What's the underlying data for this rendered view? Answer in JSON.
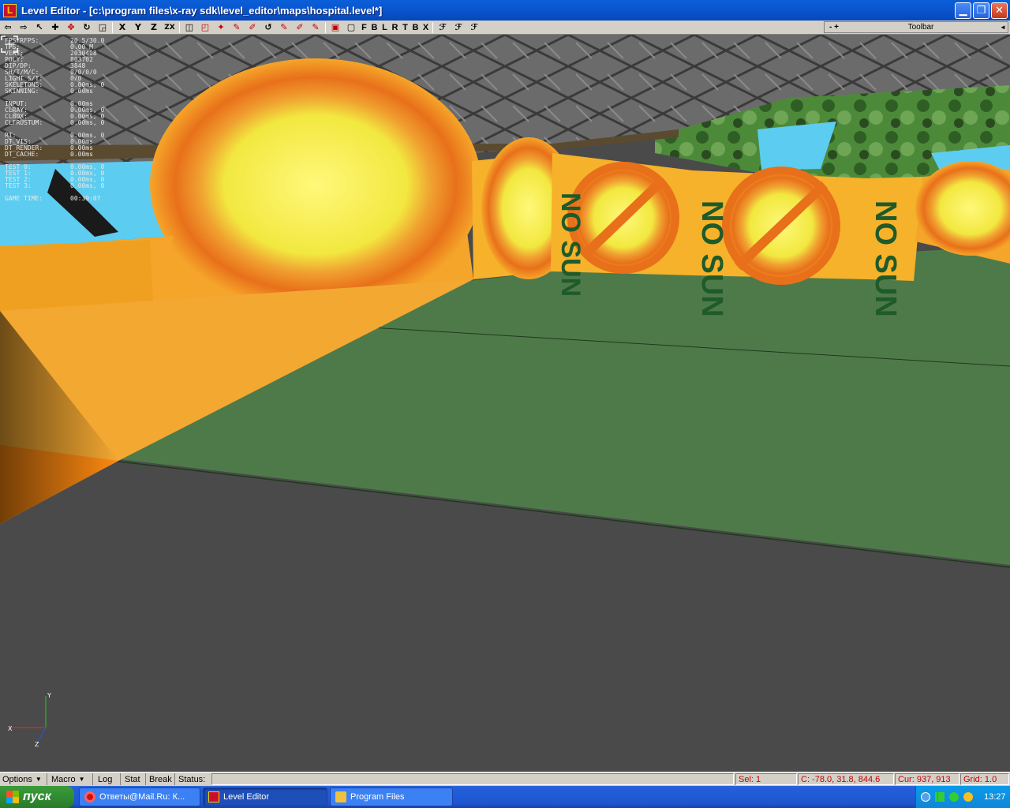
{
  "window": {
    "title": "Level Editor - [c:\\program files\\x-ray sdk\\level_editor\\maps\\hospital.level*]",
    "app_icon_letter": "L",
    "controls": {
      "minimize": "▁",
      "maximize": "❐",
      "close": "✕"
    }
  },
  "toolbar": {
    "panel": {
      "plusminus": "- +",
      "label": "Toolbar",
      "arrow": "◄"
    },
    "axis_labels": [
      "X",
      "Y",
      "Z",
      "ZX"
    ],
    "view_labels": [
      "F",
      "B",
      "L",
      "R",
      "T",
      "B",
      "X"
    ]
  },
  "stats": [
    {
      "k": "FPS/RFPS:",
      "v": "20.5/30.0"
    },
    {
      "k": "TPS:",
      "v": "0.00 M"
    },
    {
      "k": "VERT:",
      "v": "2030408"
    },
    {
      "k": "POLY:",
      "v": "803702"
    },
    {
      "k": "DIP/DP:",
      "v": "3848"
    },
    {
      "k": "SH/T/M/C:",
      "v": "0/0/0/0"
    },
    {
      "k": "LIGHT S/T:",
      "v": "0/0"
    },
    {
      "k": "SKELETONS:",
      "v": "0.00ms, 0"
    },
    {
      "k": "SKINNING:",
      "v": "0.00ms"
    },
    {
      "k": "INPUT:",
      "v": "0.00ms"
    },
    {
      "k": "CLRAY:",
      "v": "0.00ms, 0"
    },
    {
      "k": "CLBOX:",
      "v": "0.00ms, 0"
    },
    {
      "k": "CLFRUSTUM:",
      "v": "0.00ms, 0"
    },
    {
      "k": " RT:",
      "v": "0.00ms, 0"
    },
    {
      "k": " DT_VIS:",
      "v": "0.00ms"
    },
    {
      "k": " DT_RENDER:",
      "v": "0.00ms"
    },
    {
      "k": " DT_CACHE:",
      "v": "0.00ms"
    },
    {
      "k": "TEST 0:",
      "v": "0.00ms, 0"
    },
    {
      "k": "TEST 1:",
      "v": "0.00ms, 0"
    },
    {
      "k": "TEST 2:",
      "v": "0.00ms, 0"
    },
    {
      "k": "TEST 3:",
      "v": "0.00ms, 0"
    },
    {
      "k": "GAME TIME:",
      "v": "00:39:07"
    }
  ],
  "scene": {
    "billboard_text": "NO SUN",
    "colors": {
      "floor": "#4a4a4a",
      "ground": "#4e7a4a",
      "wall": "#f5a52a",
      "sky": "#60d0f0",
      "ceiling": "#6a6a6a"
    },
    "gizmo_axes": {
      "y": "Y",
      "x": "X",
      "z": "Z"
    }
  },
  "statusbar": {
    "options": "Options",
    "macro": "Macro",
    "log": "Log",
    "stat": "Stat",
    "break": "Break",
    "status_label": "Status:",
    "status_value": "",
    "sel": "Sel: 1",
    "coords": "C: -78.0, 31.8, 844.6",
    "cursor": "Cur: 937, 913",
    "grid": "Grid: 1.0"
  },
  "taskbar": {
    "start_label": "пуск",
    "tasks": [
      {
        "label": "Ответы@Mail.Ru: К...",
        "icon": "opera-icon",
        "color": "#d01010"
      },
      {
        "label": "Level Editor",
        "icon": "level-editor-icon",
        "color": "#c8102e"
      },
      {
        "label": "Program Files",
        "icon": "folder-icon",
        "color": "#f0c040"
      }
    ],
    "clock": "13:27"
  }
}
